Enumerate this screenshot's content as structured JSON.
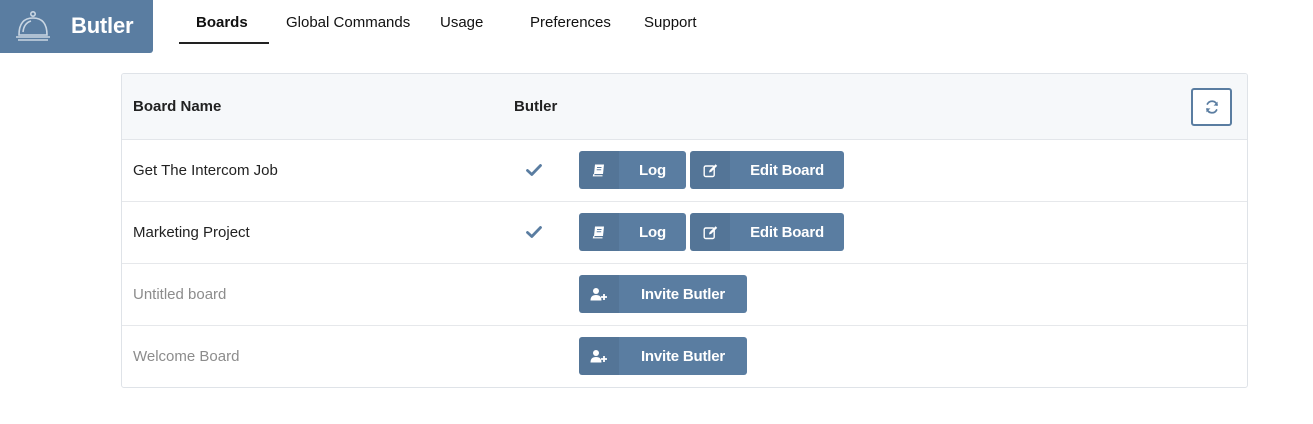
{
  "brand": {
    "name": "Butler",
    "icon": "service-bell-icon",
    "color": "#5a7da1"
  },
  "nav": {
    "tabs": [
      {
        "label": "Boards",
        "active": true
      },
      {
        "label": "Global Commands",
        "active": false
      },
      {
        "label": "Usage",
        "active": false
      },
      {
        "label": "Preferences",
        "active": false
      },
      {
        "label": "Support",
        "active": false
      }
    ]
  },
  "table": {
    "headers": {
      "board_name": "Board Name",
      "butler": "Butler"
    },
    "refresh_icon": "refresh-icon",
    "rows": [
      {
        "name": "Get The Intercom Job",
        "butler_enabled": true,
        "log_label": "Log",
        "edit_label": "Edit Board"
      },
      {
        "name": "Marketing Project",
        "butler_enabled": true,
        "log_label": "Log",
        "edit_label": "Edit Board"
      },
      {
        "name": "Untitled board",
        "butler_enabled": false,
        "invite_label": "Invite Butler"
      },
      {
        "name": "Welcome Board",
        "butler_enabled": false,
        "invite_label": "Invite Butler"
      }
    ]
  },
  "colors": {
    "accent": "#5a7da1",
    "header_bg": "#f6f8fa",
    "muted_text": "#8c8c8c"
  }
}
